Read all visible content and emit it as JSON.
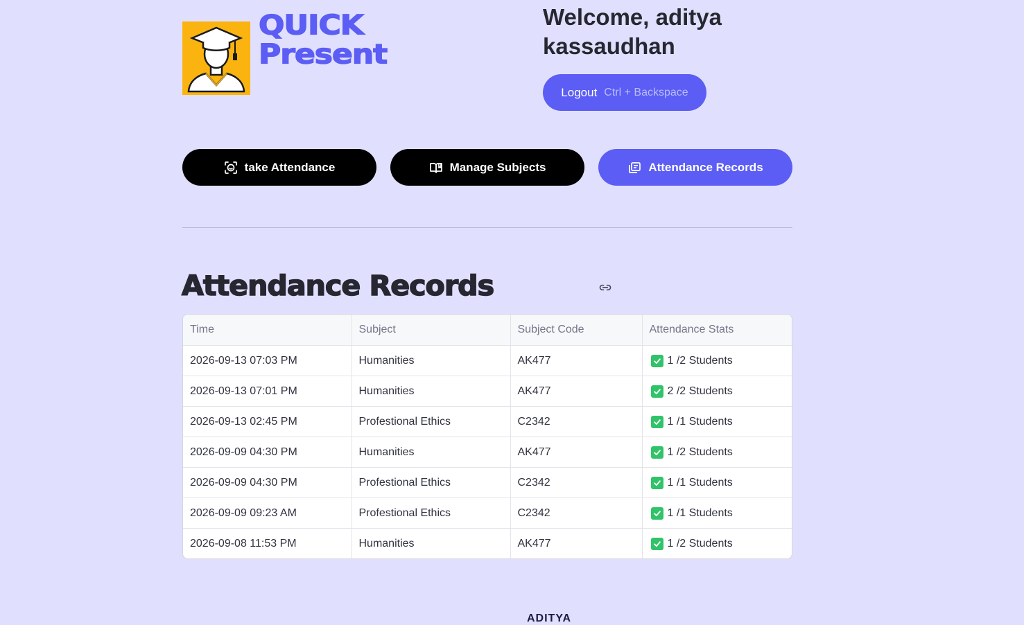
{
  "brand": {
    "line1": "QUICK",
    "line2": "Present",
    "logo_icon": "graduate-icon",
    "brand_color": "#5b5df4",
    "logo_bg": "#fbb40f"
  },
  "header": {
    "welcome": "Welcome, aditya kassaudhan"
  },
  "logout": {
    "label": "Logout",
    "shortcut": "Ctrl + Backspace"
  },
  "nav": {
    "take_attendance": {
      "label": "take Attendance",
      "icon": "face-scan-icon"
    },
    "manage_subjects": {
      "label": "Manage Subjects",
      "icon": "book-icon"
    },
    "attendance_records": {
      "label": "Attendance Records",
      "icon": "records-icon",
      "active": true
    }
  },
  "section": {
    "title": "Attendance Records",
    "anchor_icon": "link-icon"
  },
  "table": {
    "headers": [
      "Time",
      "Subject",
      "Subject Code",
      "Attendance Stats"
    ],
    "rows": [
      [
        "2026-09-13 07:03 PM",
        "Humanities",
        "AK477",
        "1 /2 Students"
      ],
      [
        "2026-09-13 07:01 PM",
        "Humanities",
        "AK477",
        "2 /2 Students"
      ],
      [
        "2026-09-13 02:45 PM",
        "Profestional Ethics",
        "C2342",
        "1 /1 Students"
      ],
      [
        "2026-09-09 04:30 PM",
        "Humanities",
        "AK477",
        "1 /2 Students"
      ],
      [
        "2026-09-09 04:30 PM",
        "Profestional Ethics",
        "C2342",
        "1 /1 Students"
      ],
      [
        "2026-09-09 09:23 AM",
        "Profestional Ethics",
        "C2342",
        "1 /1 Students"
      ],
      [
        "2026-09-08 11:53 PM",
        "Humanities",
        "AK477",
        "1 /2 Students"
      ]
    ],
    "stat_icon": "check-mark-icon",
    "stat_icon_color": "#31c36a"
  },
  "footer": {
    "partial_text": "ADITYA"
  }
}
